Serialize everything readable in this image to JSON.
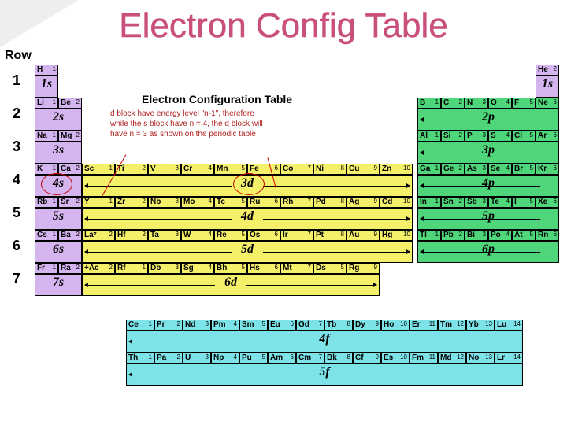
{
  "title": "Electron Config Table",
  "row_header": "Row",
  "rows": [
    "1",
    "2",
    "3",
    "4",
    "5",
    "6",
    "7"
  ],
  "sub_title": "Electron Configuration Table",
  "note_lines": [
    "d block have energy level \"n-1\", therefore",
    "while the s block have n = 4, the d block will",
    "have n = 3 as shown on the periodic table"
  ],
  "orbitals": {
    "s": [
      "1s",
      "2s",
      "3s",
      "4s",
      "5s",
      "6s",
      "7s"
    ],
    "p": [
      "2p",
      "3p",
      "4p",
      "5p",
      "6p"
    ],
    "d": [
      "3d",
      "4d",
      "5d",
      "6d"
    ],
    "f": [
      "4f",
      "5f"
    ]
  },
  "s_block": [
    [
      {
        "s": "H",
        "n": "1"
      }
    ],
    [
      {
        "s": "Li",
        "n": "1"
      },
      {
        "s": "Be",
        "n": "2"
      }
    ],
    [
      {
        "s": "Na",
        "n": "1"
      },
      {
        "s": "Mg",
        "n": "2"
      }
    ],
    [
      {
        "s": "K",
        "n": "1"
      },
      {
        "s": "Ca",
        "n": "2"
      }
    ],
    [
      {
        "s": "Rb",
        "n": "1"
      },
      {
        "s": "Sr",
        "n": "2"
      }
    ],
    [
      {
        "s": "Cs",
        "n": "1"
      },
      {
        "s": "Ba",
        "n": "2"
      }
    ],
    [
      {
        "s": "Fr",
        "n": "1"
      },
      {
        "s": "Ra",
        "n": "2"
      }
    ]
  ],
  "he": {
    "s": "He",
    "n": "2"
  },
  "p_block": [
    [
      {
        "s": "B",
        "n": "1"
      },
      {
        "s": "C",
        "n": "2"
      },
      {
        "s": "N",
        "n": "3"
      },
      {
        "s": "O",
        "n": "4"
      },
      {
        "s": "F",
        "n": "5"
      },
      {
        "s": "Ne",
        "n": "6"
      }
    ],
    [
      {
        "s": "Al",
        "n": "1"
      },
      {
        "s": "Si",
        "n": "2"
      },
      {
        "s": "P",
        "n": "3"
      },
      {
        "s": "S",
        "n": "4"
      },
      {
        "s": "Cl",
        "n": "5"
      },
      {
        "s": "Ar",
        "n": "6"
      }
    ],
    [
      {
        "s": "Ga",
        "n": "1"
      },
      {
        "s": "Ge",
        "n": "2"
      },
      {
        "s": "As",
        "n": "3"
      },
      {
        "s": "Se",
        "n": "4"
      },
      {
        "s": "Br",
        "n": "5"
      },
      {
        "s": "Kr",
        "n": "6"
      }
    ],
    [
      {
        "s": "In",
        "n": "1"
      },
      {
        "s": "Sn",
        "n": "2"
      },
      {
        "s": "Sb",
        "n": "3"
      },
      {
        "s": "Te",
        "n": "4"
      },
      {
        "s": "I",
        "n": "5"
      },
      {
        "s": "Xe",
        "n": "6"
      }
    ],
    [
      {
        "s": "Tl",
        "n": "1"
      },
      {
        "s": "Pb",
        "n": "2"
      },
      {
        "s": "Bi",
        "n": "3"
      },
      {
        "s": "Po",
        "n": "4"
      },
      {
        "s": "At",
        "n": "5"
      },
      {
        "s": "Rn",
        "n": "6"
      }
    ]
  ],
  "d_block": [
    [
      {
        "s": "Sc",
        "n": "1"
      },
      {
        "s": "Ti",
        "n": "2"
      },
      {
        "s": "V",
        "n": "3"
      },
      {
        "s": "Cr",
        "n": "4"
      },
      {
        "s": "Mn",
        "n": "5"
      },
      {
        "s": "Fe",
        "n": "6"
      },
      {
        "s": "Co",
        "n": "7"
      },
      {
        "s": "Ni",
        "n": "8"
      },
      {
        "s": "Cu",
        "n": "9"
      },
      {
        "s": "Zn",
        "n": "10"
      }
    ],
    [
      {
        "s": "Y",
        "n": "1"
      },
      {
        "s": "Zr",
        "n": "2"
      },
      {
        "s": "Nb",
        "n": "3"
      },
      {
        "s": "Mo",
        "n": "4"
      },
      {
        "s": "Tc",
        "n": "5"
      },
      {
        "s": "Ru",
        "n": "6"
      },
      {
        "s": "Rh",
        "n": "7"
      },
      {
        "s": "Pd",
        "n": "8"
      },
      {
        "s": "Ag",
        "n": "9"
      },
      {
        "s": "Cd",
        "n": "10"
      }
    ],
    [
      {
        "s": "La*",
        "n": "2"
      },
      {
        "s": "Hf",
        "n": "2"
      },
      {
        "s": "Ta",
        "n": "3"
      },
      {
        "s": "W",
        "n": "4"
      },
      {
        "s": "Re",
        "n": "5"
      },
      {
        "s": "Os",
        "n": "6"
      },
      {
        "s": "Ir",
        "n": "7"
      },
      {
        "s": "Pt",
        "n": "8"
      },
      {
        "s": "Au",
        "n": "9"
      },
      {
        "s": "Hg",
        "n": "10"
      }
    ],
    [
      {
        "s": "+Ac",
        "n": "2"
      },
      {
        "s": "Rf",
        "n": "1"
      },
      {
        "s": "Db",
        "n": "3"
      },
      {
        "s": "Sg",
        "n": "4"
      },
      {
        "s": "Bh",
        "n": "5"
      },
      {
        "s": "Hs",
        "n": "6"
      },
      {
        "s": "Mt",
        "n": "7"
      },
      {
        "s": "Ds",
        "n": "5"
      },
      {
        "s": "Rg",
        "n": "9"
      }
    ]
  ],
  "f_block": [
    [
      {
        "s": "Ce",
        "n": "1"
      },
      {
        "s": "Pr",
        "n": "2"
      },
      {
        "s": "Nd",
        "n": "3"
      },
      {
        "s": "Pm",
        "n": "4"
      },
      {
        "s": "Sm",
        "n": "5"
      },
      {
        "s": "Eu",
        "n": "6"
      },
      {
        "s": "Gd",
        "n": "7"
      },
      {
        "s": "Tb",
        "n": "8"
      },
      {
        "s": "Dy",
        "n": "9"
      },
      {
        "s": "Ho",
        "n": "10"
      },
      {
        "s": "Er",
        "n": "11"
      },
      {
        "s": "Tm",
        "n": "12"
      },
      {
        "s": "Yb",
        "n": "13"
      },
      {
        "s": "Lu",
        "n": "14"
      }
    ],
    [
      {
        "s": "Th",
        "n": "1"
      },
      {
        "s": "Pa",
        "n": "2"
      },
      {
        "s": "U",
        "n": "3"
      },
      {
        "s": "Np",
        "n": "4"
      },
      {
        "s": "Pu",
        "n": "5"
      },
      {
        "s": "Am",
        "n": "6"
      },
      {
        "s": "Cm",
        "n": "7"
      },
      {
        "s": "Bk",
        "n": "8"
      },
      {
        "s": "Cf",
        "n": "9"
      },
      {
        "s": "Es",
        "n": "10"
      },
      {
        "s": "Fm",
        "n": "11"
      },
      {
        "s": "Md",
        "n": "12"
      },
      {
        "s": "No",
        "n": "13"
      },
      {
        "s": "Lr",
        "n": "14"
      }
    ]
  ]
}
